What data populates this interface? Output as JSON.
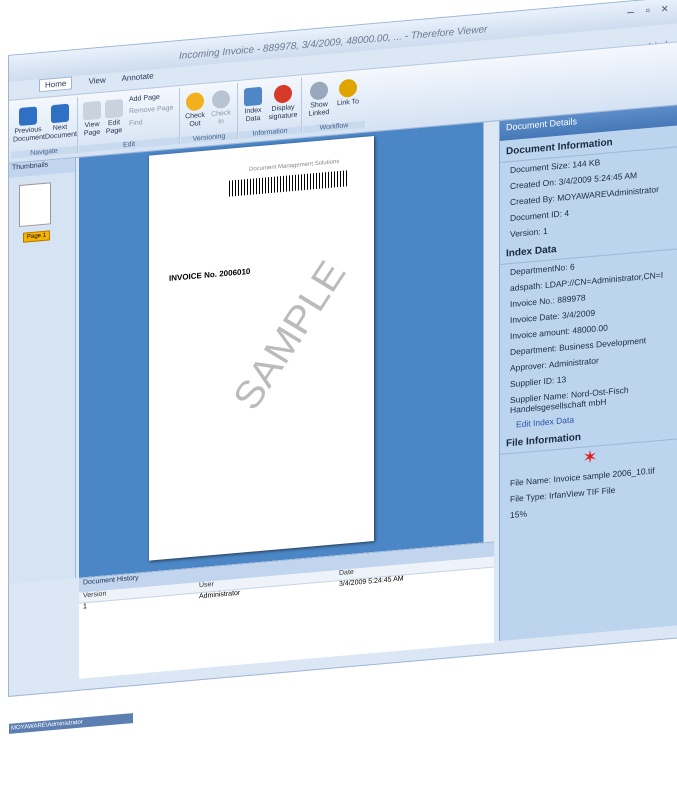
{
  "window": {
    "title": "Incoming Invoice - 889978, 3/4/2009, 48000.00, ... - Therefore Viewer",
    "help": "Help",
    "controls": [
      "–",
      "▫",
      "×"
    ]
  },
  "ribbon": {
    "tabs": [
      "Home",
      "View",
      "Annotate"
    ],
    "groups": {
      "navigate": {
        "label": "Navigate",
        "prev": "Previous Document",
        "next": "Next Document"
      },
      "edit": {
        "label": "Edit",
        "view_page": "View Page",
        "edit_page": "Edit Page",
        "add_page": "Add Page",
        "remove_page": "Remove Page",
        "find": "Find"
      },
      "versioning": {
        "label": "Versioning",
        "check_out": "Check Out",
        "check_in": "Check In"
      },
      "information": {
        "label": "Information",
        "index_data": "Index Data",
        "display_signature": "Display signature"
      },
      "workflow": {
        "label": "Workflow",
        "show_linked": "Show Linked",
        "link_to": "Link To"
      }
    }
  },
  "thumbnails": {
    "title": "Thumbnails",
    "page_label": "Page 1"
  },
  "status_user": "MOYAWARE\\Administrator",
  "document_history": {
    "title": "Document History",
    "columns": [
      "Version",
      "User",
      "Date"
    ],
    "rows": [
      {
        "version": "1",
        "user": "Administrator",
        "date": "3/4/2009 5:24:45 AM"
      }
    ]
  },
  "details": {
    "title": "Document Details",
    "doc_info": {
      "header": "Document Information",
      "size": "Document Size: 144 KB",
      "created_on": "Created On: 3/4/2009 5:24:45 AM",
      "created_by": "Created By: MOYAWARE\\Administrator",
      "doc_id": "Document ID: 4",
      "version": "Version: 1"
    },
    "index_data": {
      "header": "Index Data",
      "department_no": "DepartmentNo: 6",
      "adspath": "adspath: LDAP://CN=Administrator,CN=I",
      "invoice_no": "Invoice No.: 889978",
      "invoice_date": "Invoice Date: 3/4/2009",
      "invoice_amount": "Invoice amount: 48000.00",
      "department": "Department: Business Development",
      "approver": "Approver: Administrator",
      "supplier_id": "Supplier ID: 13",
      "supplier_name": "Supplier Name: Nord-Ost-Fisch Handelsgesellschaft mbH",
      "edit_link": "Edit Index Data"
    },
    "file_info": {
      "header": "File Information",
      "file_name": "File Name: Invoice sample 2006_10.tif",
      "file_type": "File Type: IrfanView TIF File"
    }
  },
  "zoom": "15%",
  "invoice_preview": {
    "header": "Document Management Solutions",
    "title": "INVOICE No. 2006010",
    "watermark": "SAMPLE"
  }
}
